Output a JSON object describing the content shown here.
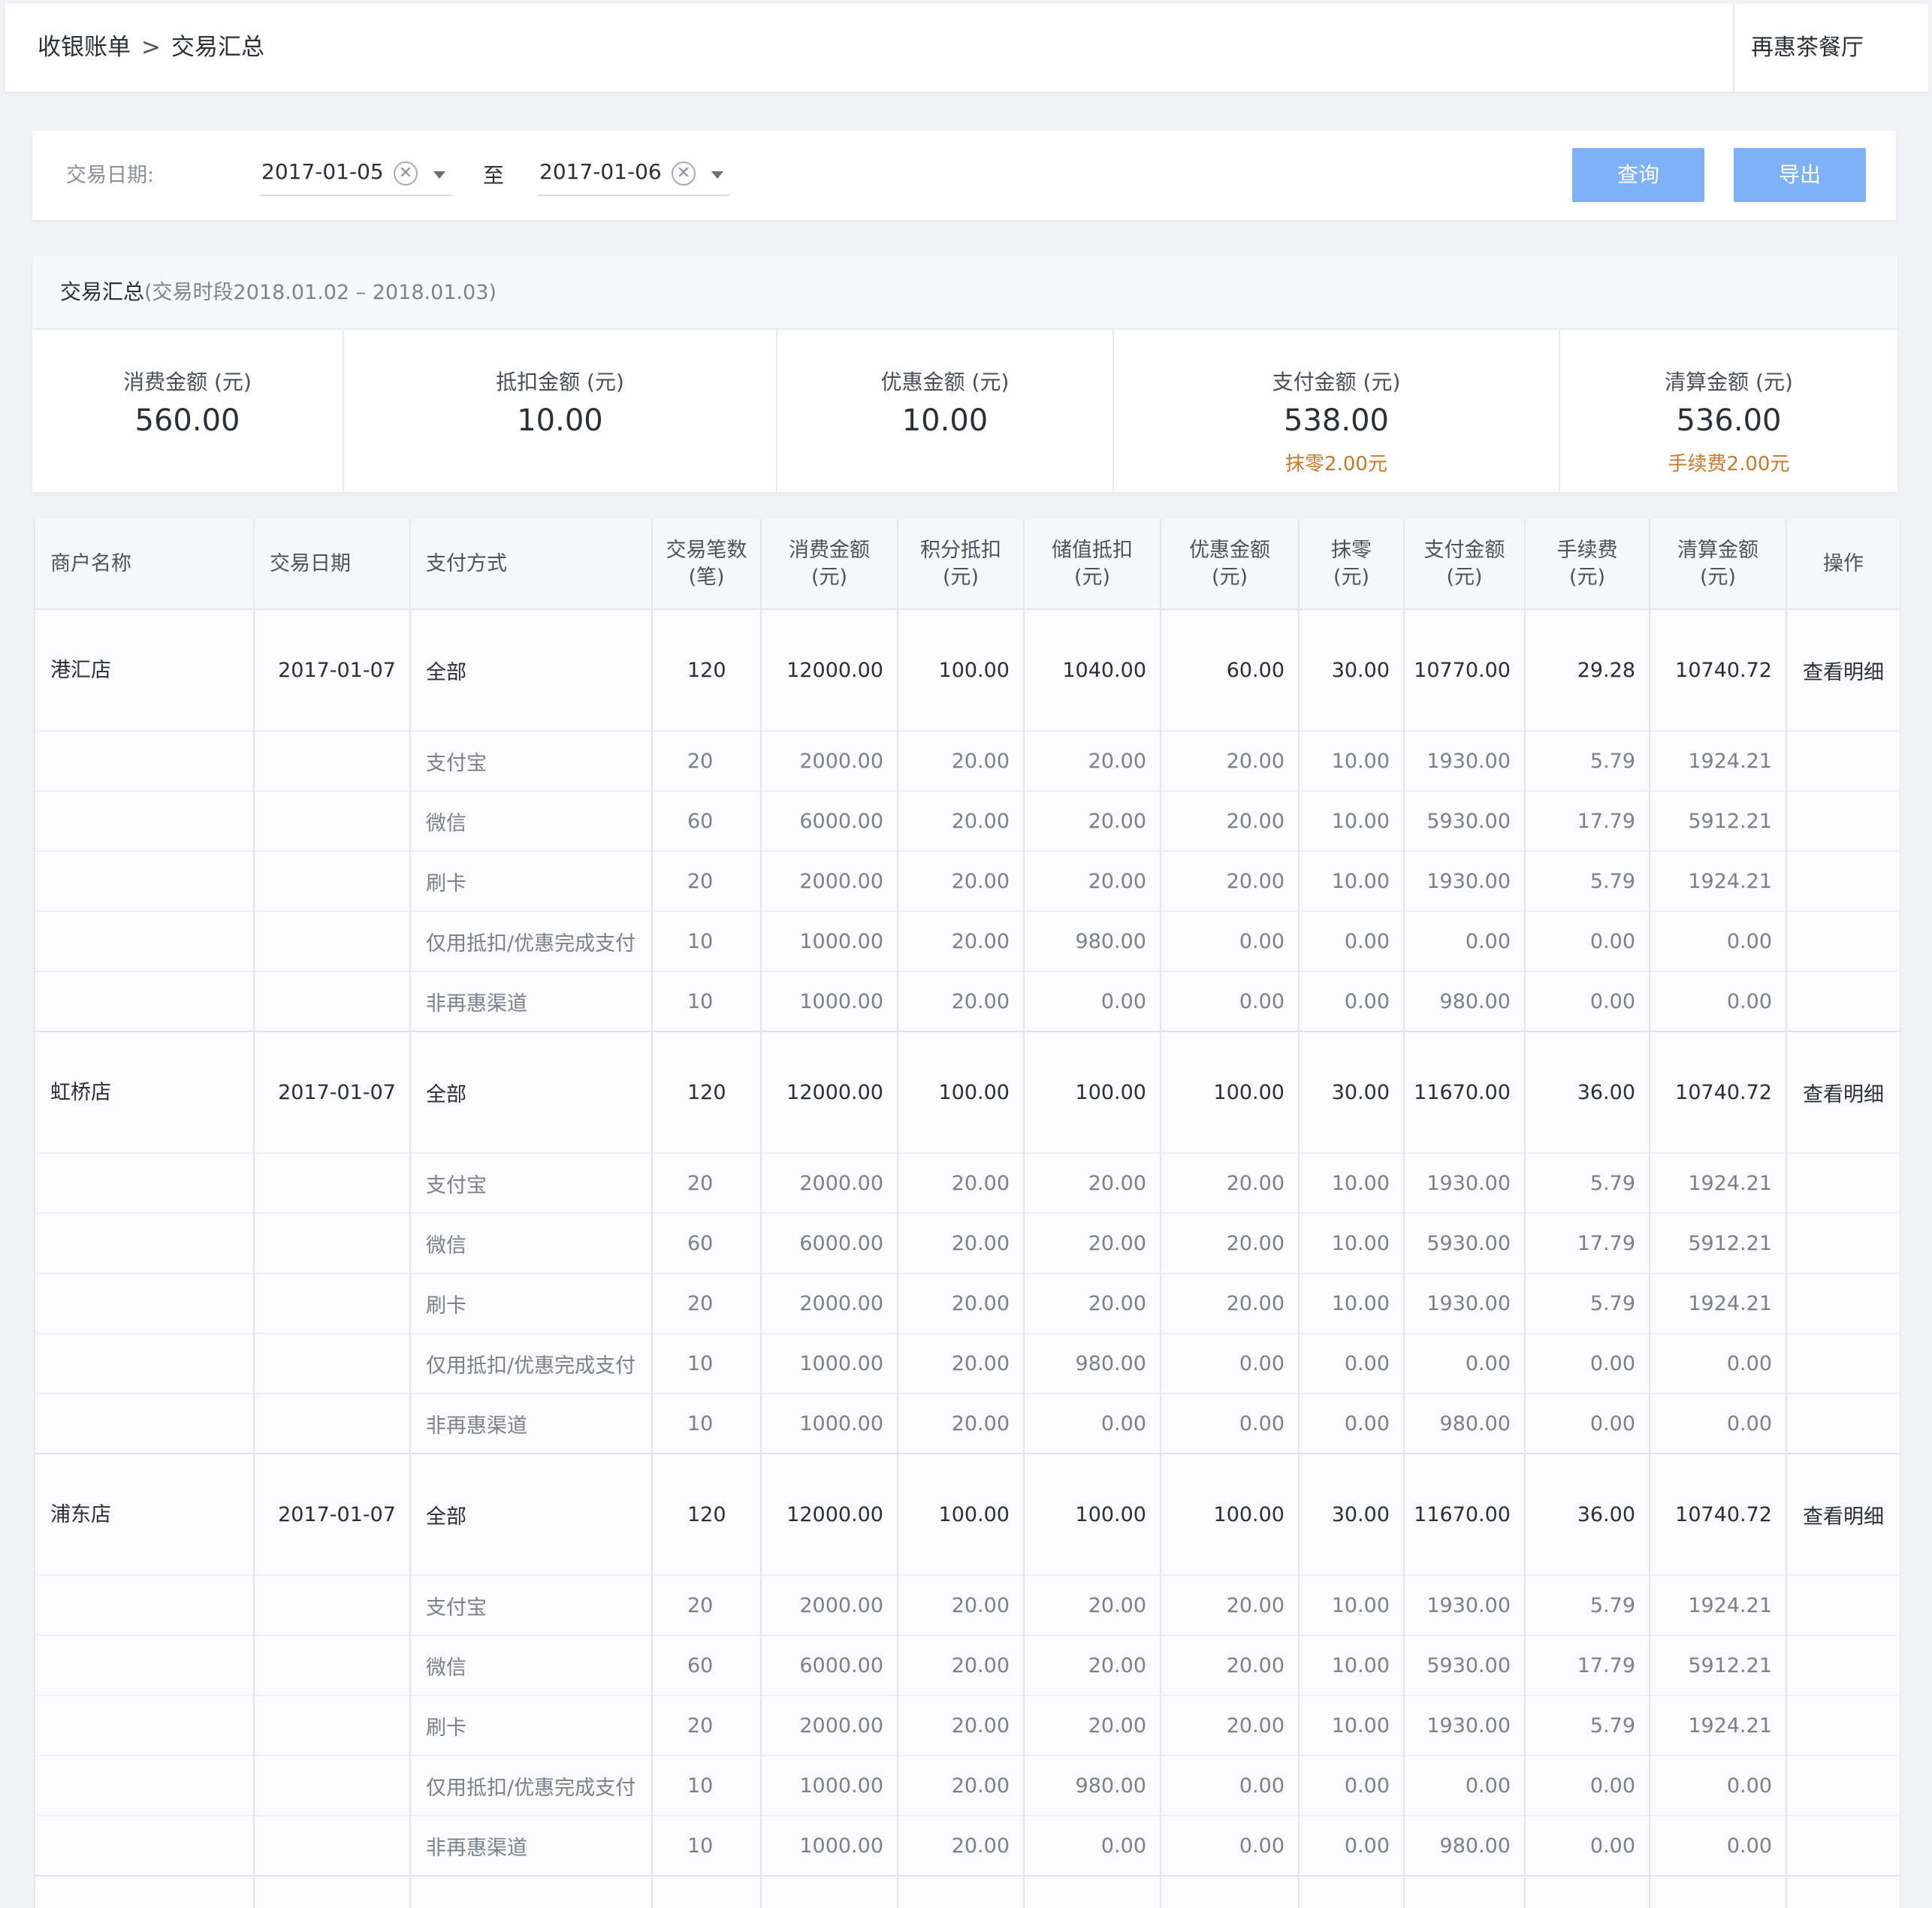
{
  "header": {
    "crumb_root": "收银账单",
    "crumb_sep": ">",
    "crumb_current": "交易汇总",
    "shop_name": "再惠茶餐厅"
  },
  "filter": {
    "label": "交易日期:",
    "start_date": "2017-01-05",
    "to_label": "至",
    "end_date": "2017-01-06",
    "query_label": "查询",
    "export_label": "导出"
  },
  "summary": {
    "title": "交易汇总",
    "period": "(交易时段2018.01.02 – 2018.01.03)",
    "stats": [
      {
        "label": "消费金额 (元)",
        "value": "560.00",
        "note": ""
      },
      {
        "label": "抵扣金额 (元)",
        "value": "10.00",
        "note": ""
      },
      {
        "label": "优惠金额 (元)",
        "value": "10.00",
        "note": ""
      },
      {
        "label": "支付金额 (元)",
        "value": "538.00",
        "note": "抹零2.00元"
      },
      {
        "label": "清算金额 (元)",
        "value": "536.00",
        "note": "手续费2.00元"
      }
    ]
  },
  "table": {
    "headers": [
      [
        "商户名称"
      ],
      [
        "交易日期"
      ],
      [
        "支付方式"
      ],
      [
        "交易笔数",
        "(笔)"
      ],
      [
        "消费金额",
        "(元)"
      ],
      [
        "积分抵扣",
        "(元)"
      ],
      [
        "储值抵扣",
        "(元)"
      ],
      [
        "优惠金额",
        "(元)"
      ],
      [
        "抹零",
        "(元)"
      ],
      [
        "支付金额",
        "(元)"
      ],
      [
        "手续费",
        "(元)"
      ],
      [
        "清算金额",
        "(元)"
      ],
      [
        "操作"
      ]
    ],
    "groups": [
      {
        "store": "港汇店",
        "date": "2017-01-07",
        "action": "查看明细",
        "rows": [
          [
            "全部",
            "120",
            "12000.00",
            "100.00",
            "1040.00",
            "60.00",
            "30.00",
            "10770.00",
            "29.28",
            "10740.72"
          ],
          [
            "支付宝",
            "20",
            "2000.00",
            "20.00",
            "20.00",
            "20.00",
            "10.00",
            "1930.00",
            "5.79",
            "1924.21"
          ],
          [
            "微信",
            "60",
            "6000.00",
            "20.00",
            "20.00",
            "20.00",
            "10.00",
            "5930.00",
            "17.79",
            "5912.21"
          ],
          [
            "刷卡",
            "20",
            "2000.00",
            "20.00",
            "20.00",
            "20.00",
            "10.00",
            "1930.00",
            "5.79",
            "1924.21"
          ],
          [
            "仅用抵扣/优惠完成支付",
            "10",
            "1000.00",
            "20.00",
            "980.00",
            "0.00",
            "0.00",
            "0.00",
            "0.00",
            "0.00"
          ],
          [
            "非再惠渠道",
            "10",
            "1000.00",
            "20.00",
            "0.00",
            "0.00",
            "0.00",
            "980.00",
            "0.00",
            "0.00"
          ]
        ]
      },
      {
        "store": "虹桥店",
        "date": "2017-01-07",
        "action": "查看明细",
        "rows": [
          [
            "全部",
            "120",
            "12000.00",
            "100.00",
            "100.00",
            "100.00",
            "30.00",
            "11670.00",
            "36.00",
            "10740.72"
          ],
          [
            "支付宝",
            "20",
            "2000.00",
            "20.00",
            "20.00",
            "20.00",
            "10.00",
            "1930.00",
            "5.79",
            "1924.21"
          ],
          [
            "微信",
            "60",
            "6000.00",
            "20.00",
            "20.00",
            "20.00",
            "10.00",
            "5930.00",
            "17.79",
            "5912.21"
          ],
          [
            "刷卡",
            "20",
            "2000.00",
            "20.00",
            "20.00",
            "20.00",
            "10.00",
            "1930.00",
            "5.79",
            "1924.21"
          ],
          [
            "仅用抵扣/优惠完成支付",
            "10",
            "1000.00",
            "20.00",
            "980.00",
            "0.00",
            "0.00",
            "0.00",
            "0.00",
            "0.00"
          ],
          [
            "非再惠渠道",
            "10",
            "1000.00",
            "20.00",
            "0.00",
            "0.00",
            "0.00",
            "980.00",
            "0.00",
            "0.00"
          ]
        ]
      },
      {
        "store": "浦东店",
        "date": "2017-01-07",
        "action": "查看明细",
        "rows": [
          [
            "全部",
            "120",
            "12000.00",
            "100.00",
            "100.00",
            "100.00",
            "30.00",
            "11670.00",
            "36.00",
            "10740.72"
          ],
          [
            "支付宝",
            "20",
            "2000.00",
            "20.00",
            "20.00",
            "20.00",
            "10.00",
            "1930.00",
            "5.79",
            "1924.21"
          ],
          [
            "微信",
            "60",
            "6000.00",
            "20.00",
            "20.00",
            "20.00",
            "10.00",
            "5930.00",
            "17.79",
            "5912.21"
          ],
          [
            "刷卡",
            "20",
            "2000.00",
            "20.00",
            "20.00",
            "20.00",
            "10.00",
            "1930.00",
            "5.79",
            "1924.21"
          ],
          [
            "仅用抵扣/优惠完成支付",
            "10",
            "1000.00",
            "20.00",
            "980.00",
            "0.00",
            "0.00",
            "0.00",
            "0.00",
            "0.00"
          ],
          [
            "非再惠渠道",
            "10",
            "1000.00",
            "20.00",
            "0.00",
            "0.00",
            "0.00",
            "980.00",
            "0.00",
            "0.00"
          ]
        ]
      }
    ]
  },
  "colors": {
    "accent": "#7fb1f7",
    "link": "#5e9cf0",
    "note": "#c9792a",
    "background": "#f0f2f5"
  }
}
